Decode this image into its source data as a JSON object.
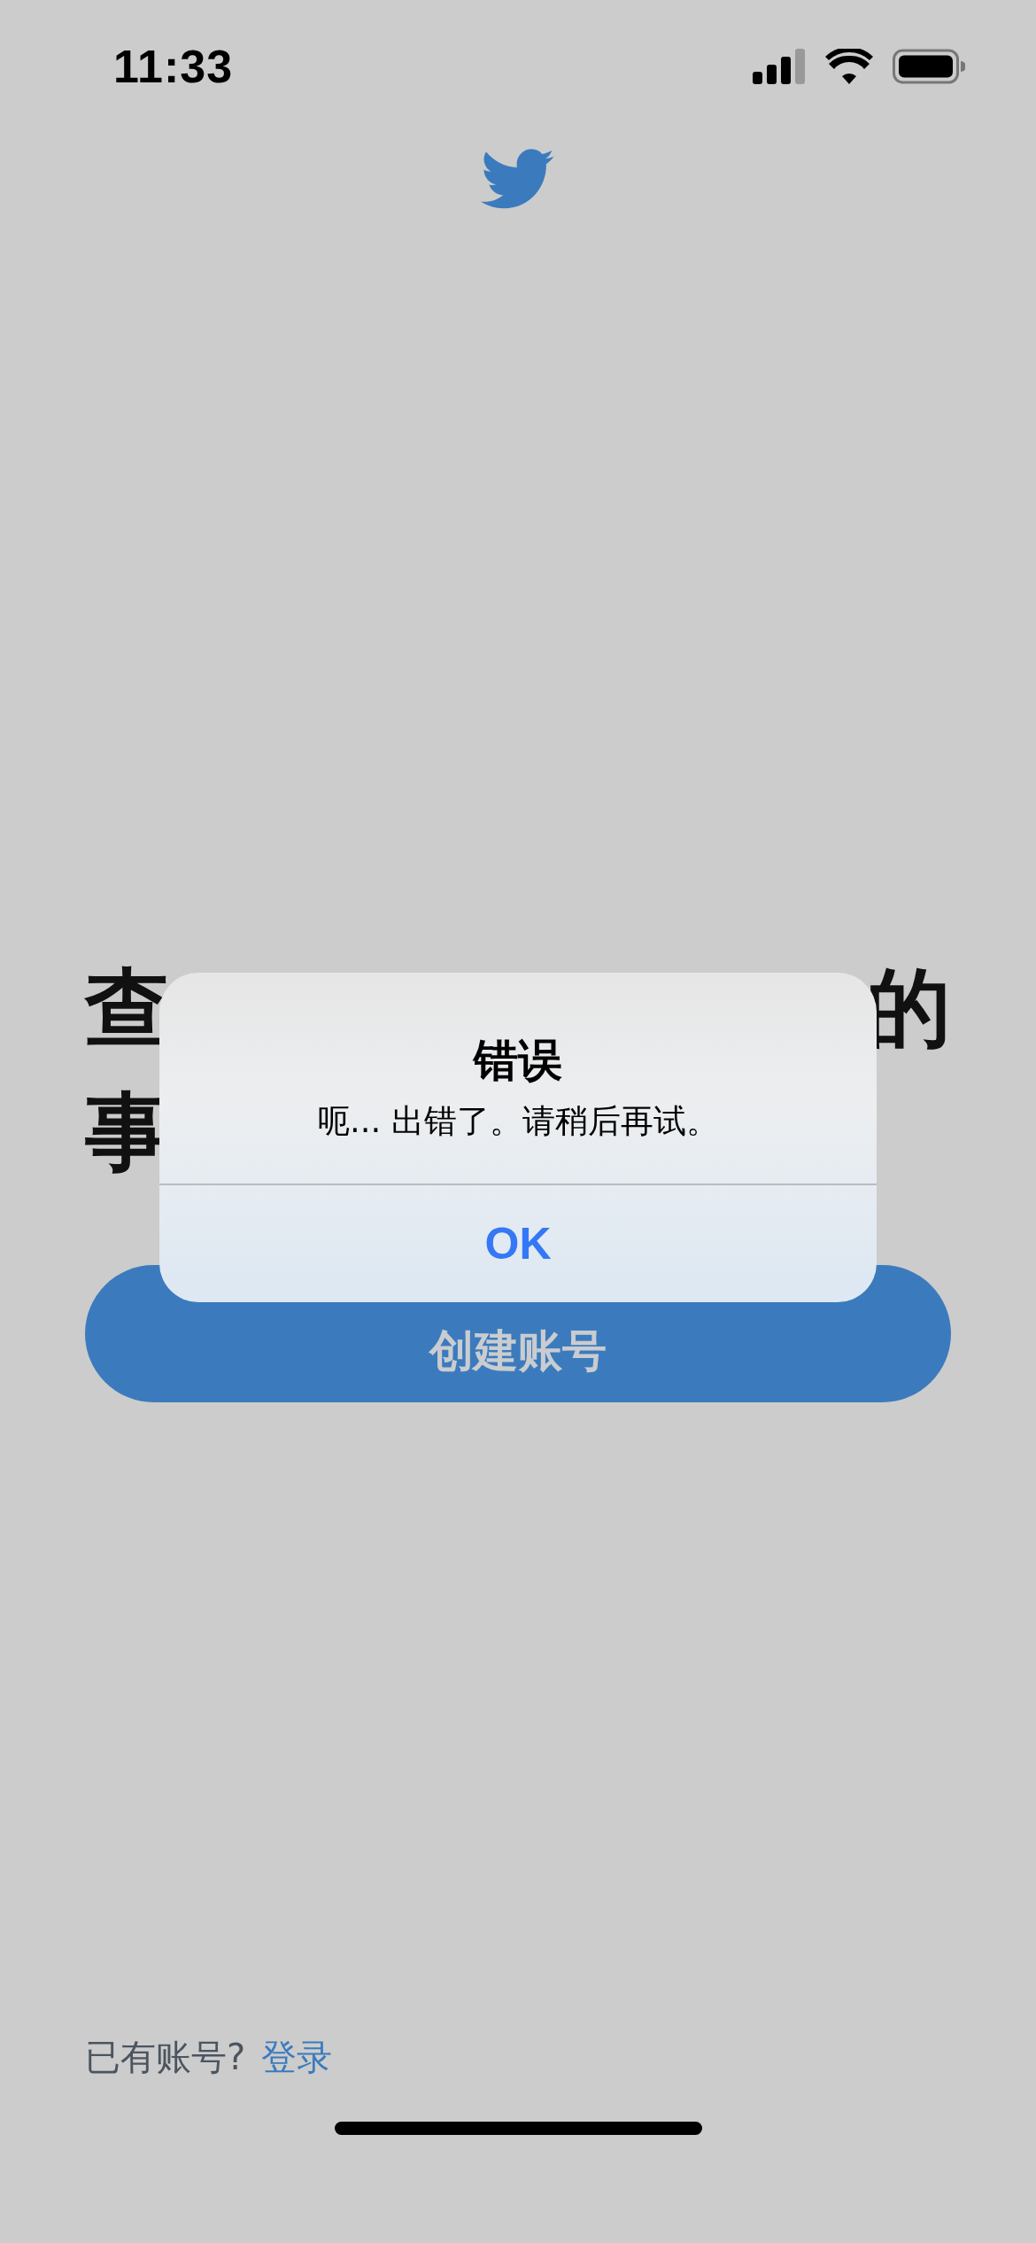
{
  "status_bar": {
    "time": "11:33"
  },
  "headline": {
    "line_1_start": "查",
    "line_1_end": "的",
    "line_2_start": "事"
  },
  "create_account_button": {
    "label": "创建账号"
  },
  "footer": {
    "prompt": "已有账号?",
    "link": "登录"
  },
  "alert": {
    "title": "错误",
    "message": "呃... 出错了。请稍后再试。",
    "buttons": [
      "OK"
    ]
  }
}
